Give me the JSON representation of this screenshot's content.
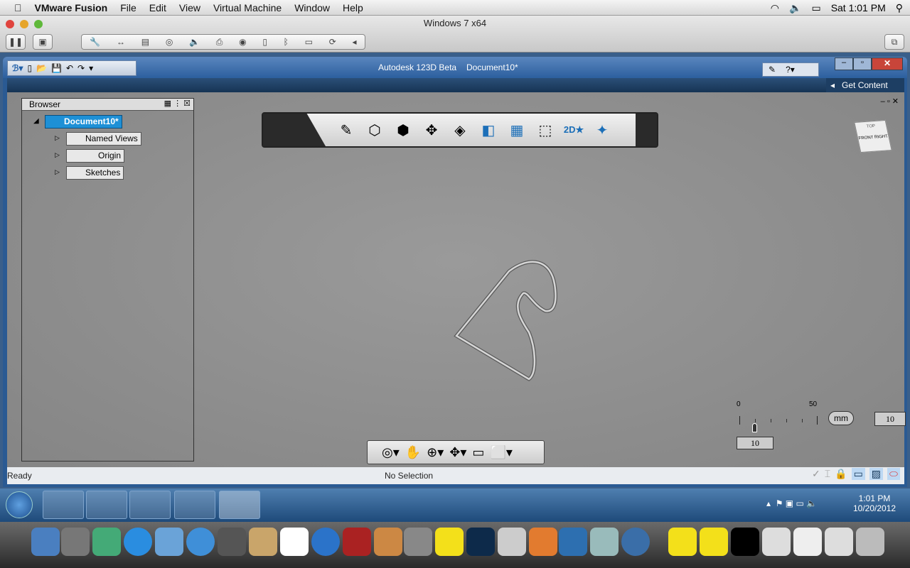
{
  "mac_menu": {
    "app": "VMware Fusion",
    "items": [
      "File",
      "Edit",
      "View",
      "Virtual Machine",
      "Window",
      "Help"
    ],
    "clock": "Sat 1:01 PM"
  },
  "vm": {
    "title": "Windows 7 x64"
  },
  "app": {
    "title": "Autodesk 123D Beta",
    "document": "Document10*",
    "get_content": "Get Content"
  },
  "browser": {
    "title": "Browser",
    "root": "Document10*",
    "items": [
      "Named Views",
      "Origin",
      "Sketches"
    ]
  },
  "grid": {
    "scale_min": "0",
    "scale_max": "50",
    "unit": "mm",
    "value": "10",
    "value2": "10"
  },
  "status": {
    "left": "Ready",
    "center": "No Selection"
  },
  "taskbar": {
    "time": "1:01 PM",
    "date": "10/20/2012"
  },
  "viewcube": {
    "top": "TOP",
    "front": "FRONT",
    "right": "RIGHT"
  }
}
